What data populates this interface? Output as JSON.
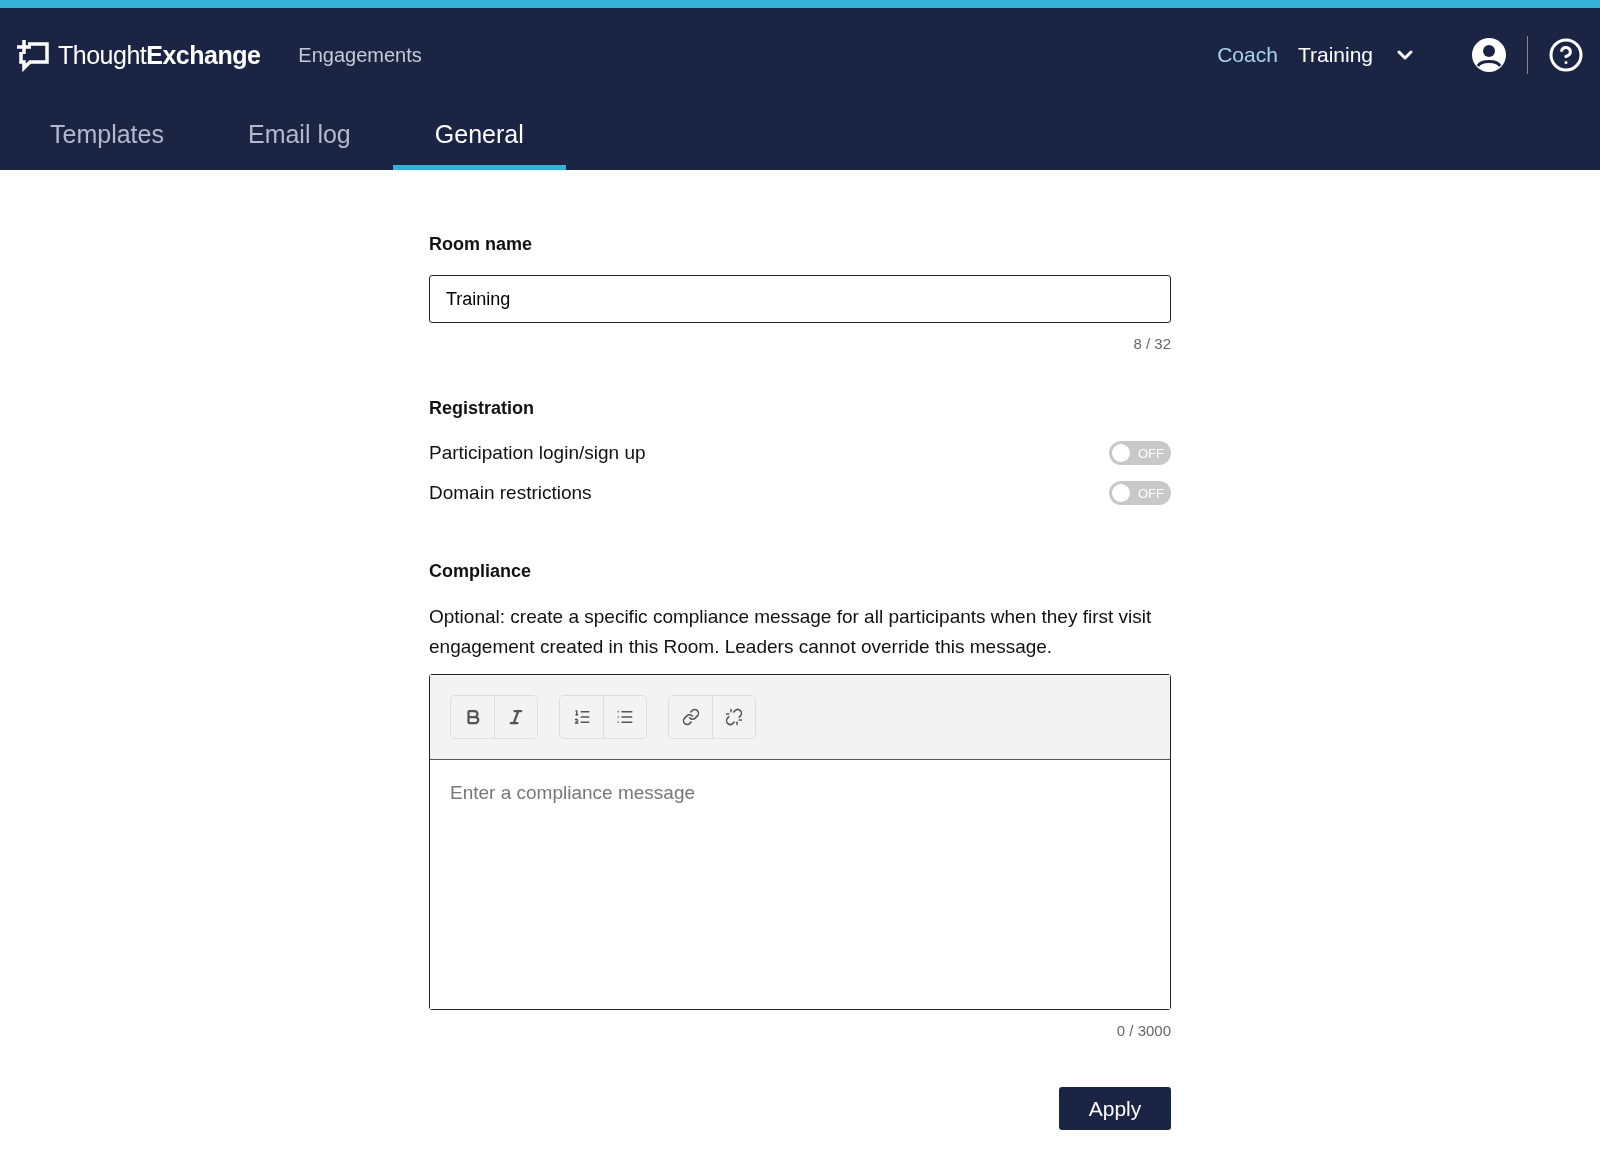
{
  "header": {
    "brand_light": "Thought",
    "brand_bold": "Exchange",
    "nav": "Engagements",
    "coach": "Coach",
    "room_menu": "Training"
  },
  "tabs": [
    {
      "label": "Templates",
      "selected": false
    },
    {
      "label": "Email log",
      "selected": false
    },
    {
      "label": "General",
      "selected": true
    }
  ],
  "room_name": {
    "label": "Room name",
    "value": "Training",
    "counter": "8 / 32"
  },
  "registration": {
    "title": "Registration",
    "settings": [
      {
        "label": "Participation login/sign up",
        "on": false,
        "state_text": "OFF"
      },
      {
        "label": "Domain restrictions",
        "on": false,
        "state_text": "OFF"
      }
    ]
  },
  "compliance": {
    "title": "Compliance",
    "description": "Optional: create a specific compliance message for all participants when they first visit engagement created in this Room. Leaders cannot override this message.",
    "toolbar": [
      [
        {
          "kind": "bold"
        },
        {
          "kind": "italic"
        }
      ],
      [
        {
          "kind": "ordered"
        },
        {
          "kind": "bullet"
        }
      ],
      [
        {
          "kind": "link"
        },
        {
          "kind": "unlink"
        }
      ]
    ],
    "placeholder": "Enter a compliance message",
    "counter": "0 / 3000"
  },
  "apply_button": "Apply"
}
